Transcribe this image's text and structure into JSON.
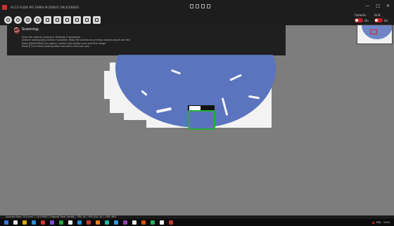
{
  "window": {
    "title": "ACCU-SLIDE MS 20984-W DEBUG UNLICENSED",
    "controls": [
      "—",
      "□",
      "✕"
    ]
  },
  "toolbar": {
    "tools": [
      {
        "name": "eye-icon"
      },
      {
        "name": "camera-icon"
      },
      {
        "name": "zoom-in-icon"
      },
      {
        "name": "zoom-out-icon"
      },
      {
        "name": "edit-icon"
      },
      {
        "name": "scan-icon"
      },
      {
        "name": "stage-icon"
      },
      {
        "name": "save-icon"
      },
      {
        "name": "export-icon"
      },
      {
        "name": "settings-icon"
      }
    ]
  },
  "camera_panel": {
    "camera_label": "Camera",
    "grid_label": "Grid",
    "camera_state": "On",
    "grid_state": "On"
  },
  "scan_panel": {
    "title": "Scanning:",
    "lines": [
      "Scan the slide by moving it. Release if necessary.",
      "Acquire overlapping stripes if possible. Keep the overlap to previous stripes above one tile.",
      "Press [BACKSPACE] to rewind, correct and realign scan and fine image.",
      "Press [F] to freeze existing data and add a new sub scan."
    ]
  },
  "status": {
    "text": "Scanned Area: 35.0 mm² │ 30.0 MP/S │ Elapsed Time: 0m48s │ FPS: 40 │ FPS (GS): 40 │ CPU: 46%"
  },
  "taskbar": {
    "icons": [
      "#3a7bd5",
      "#e6e6e6",
      "#e0a800",
      "#2f8fd8",
      "#d13438",
      "#7a4fd1",
      "#2ea043",
      "#f0f0f0",
      "#2f8fd8",
      "#c0392b",
      "#e67e22",
      "#1abc9c",
      "#3498db",
      "#8e44ad",
      "#ecf0f1",
      "#d35400",
      "#27ae60",
      "#ffffff",
      "#c0392b"
    ],
    "time": "10:01",
    "lang": "ENG"
  },
  "colors": {
    "accent_red": "#c21e2a",
    "fov_green": "#27ad3a",
    "tissue_blue": "#5a74be"
  }
}
